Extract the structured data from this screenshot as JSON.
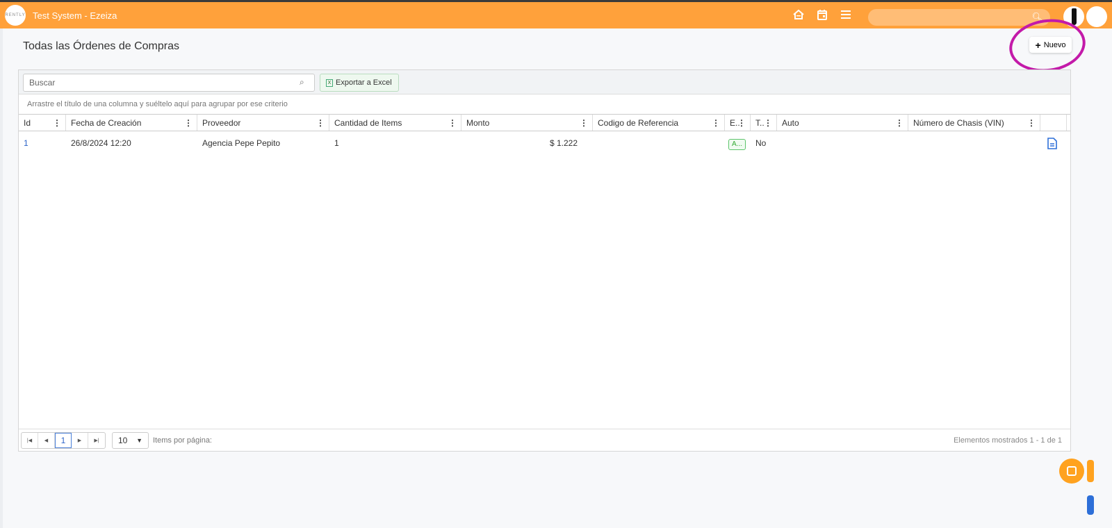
{
  "nav": {
    "logo": "RENTLY",
    "title": "Test System - Ezeiza",
    "search_placeholder": "",
    "icons": [
      "home-icon",
      "calendar-icon",
      "menu-icon",
      "search-icon"
    ]
  },
  "page": {
    "title": "Todas las Órdenes de Compras",
    "new_button": "Nuevo"
  },
  "toolbar": {
    "search_placeholder": "Buscar",
    "export_label": "Exportar a Excel"
  },
  "group_hint": "Arrastre el título de una columna y suéltelo aquí para agrupar por ese criterio",
  "columns": [
    "Id",
    "Fecha de Creación",
    "Proveedor",
    "Cantidad de Items",
    "Monto",
    "Codigo de Referencia",
    "E..",
    "T..",
    "Auto",
    "Número de Chasis (VIN)",
    ""
  ],
  "rows": [
    {
      "id": "1",
      "fecha": "26/8/2024 12:20",
      "proveedor": "Agencia Pepe Pepito",
      "cantidad": "1",
      "monto": "$ 1.222",
      "codigo": "",
      "estado": "A...",
      "t": "No",
      "auto": "",
      "vin": ""
    }
  ],
  "pager": {
    "current": "1",
    "page_size": "10",
    "items_label": "Items por página:",
    "shown": "Elementos mostrados 1 - 1 de 1"
  },
  "colors": {
    "nav": "#ffa13b",
    "accent": "#2d64c9",
    "status": "#3a3"
  }
}
